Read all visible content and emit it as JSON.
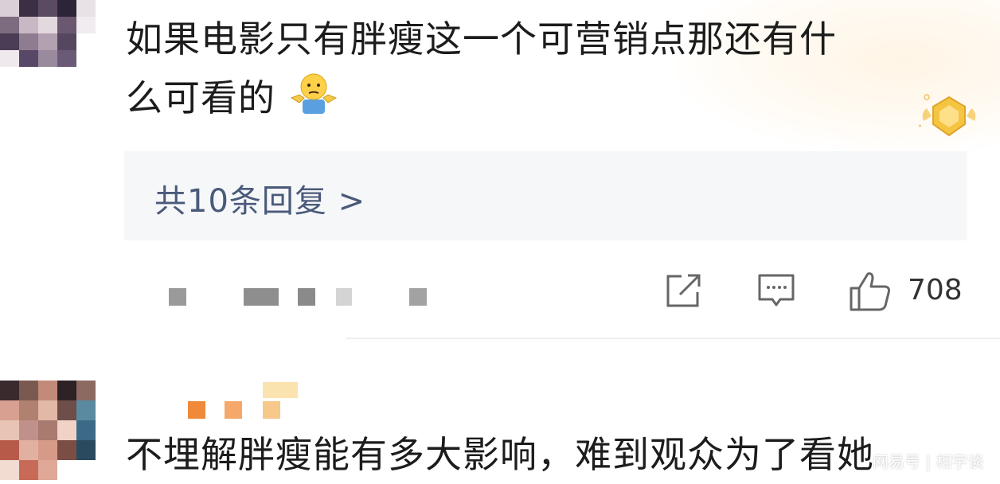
{
  "comment1": {
    "text_line1": "如果电影只有胖瘦这一个可营销点那还有什",
    "text_line2": "么可看的",
    "emoji": "shrug-emoji"
  },
  "replies": {
    "label": "共10条回复 >"
  },
  "actions": {
    "like_count": "708"
  },
  "comment2": {
    "text": "不埋解胖瘦能有多大影响，难到观众为了看她"
  },
  "watermark": {
    "text": "网易号 | 相宇谈"
  },
  "colors": {
    "reply_text": "#4a5a7a",
    "reply_bg": "#f6f7f9",
    "badge_gold": "#f5c542"
  }
}
